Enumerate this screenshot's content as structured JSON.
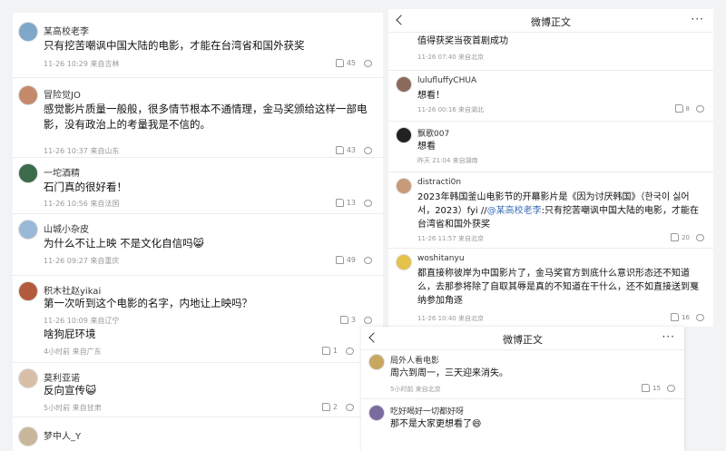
{
  "left_panel": {
    "comments": [
      {
        "user": "某高校老李",
        "text": "只有挖苦嘲讽中国大陆的电影，才能在台湾省和国外获奖",
        "meta": "11-26 10:29 来自吉林",
        "likes": "45"
      },
      {
        "user": "冒险觉JO",
        "text": "感觉影片质量一般般，很多情节根本不通情理，金马奖颁给这样一部电影，没有政治上的考量我是不信的。",
        "meta": "11-26 10:37 来自山东",
        "likes": "43"
      },
      {
        "user": "一坨酒精",
        "text": "石门真的很好看！",
        "meta": "11-26 10:56 来自法国",
        "likes": "13"
      },
      {
        "user": "山城小杂皮",
        "text": "为什么不让上映 不是文化自信吗😸",
        "meta": "11-26 09:27 来自重庆",
        "likes": "49"
      },
      {
        "user": "积木社赵yikai",
        "text": "第一次听到这个电影的名字，内地让上映吗？",
        "meta": "11-26 10:09 来自辽宁",
        "likes": "3"
      },
      {
        "user": "",
        "text": "啥狗屁环境",
        "meta": "4小时前 来自广东",
        "likes": "1"
      },
      {
        "user": "莫利亚诺",
        "text": "反向宣传😺",
        "meta": "5小时前 来自甘肃",
        "likes": "2"
      },
      {
        "user": "梦中人_Y",
        "text": "",
        "meta": "",
        "likes": ""
      }
    ]
  },
  "right_panel": {
    "title": "微博正文",
    "more": "···",
    "comments": [
      {
        "user": "",
        "text": "值得获奖当夜首剧成功",
        "meta": "11-26 07:40 来自北京",
        "likes": ""
      },
      {
        "user": "lulufluffyCHUA",
        "text": "想看！",
        "meta": "11-26 00:16 来自湖北",
        "likes": "8"
      },
      {
        "user": "飘歌007",
        "text": "想看",
        "meta": "昨天 21:04 来自湖南",
        "likes": ""
      },
      {
        "user": "distracti0n",
        "text_plain": "2023年韩国釜山电影节的开幕影片是《因为讨厌韩国》（한국이 싫어서，2023）fyi //",
        "mention": "@某高校老李",
        "text_after": ":只有挖苦嘲讽中国大陆的电影，才能在台湾省和国外获奖",
        "meta": "11-26 11:57 来自北京",
        "likes": "20"
      },
      {
        "user": "woshitanyu",
        "text": "都直接称彼岸为中国影片了，金马奖官方到底什么意识形态还不知道么，去那参将除了自取其辱是真的不知道在干什么，还不如直接送到戛纳参加角逐",
        "meta": "11-26 10:40 来自北京",
        "likes": "16"
      }
    ]
  },
  "bottom_panel": {
    "title": "微博正文",
    "more": "···",
    "comments": [
      {
        "user": "局外人看电影",
        "text": "周六到周一，三天迎来消失。",
        "meta": "5小时前 来自北京",
        "likes": "15"
      },
      {
        "user": "吃好喝好一切都好呀",
        "text": "那不是大家更想看了😄",
        "meta": "",
        "likes": ""
      }
    ]
  }
}
